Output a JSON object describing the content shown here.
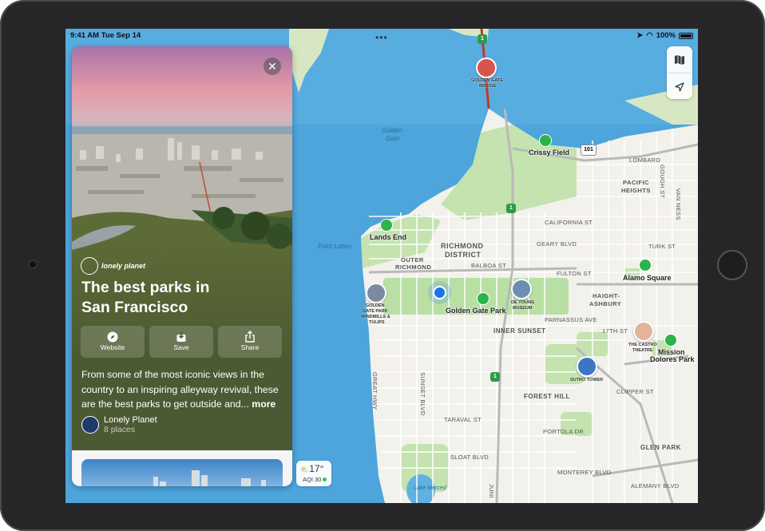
{
  "status_bar": {
    "time": "9:41 AM",
    "date": "Tue Sep 14",
    "battery": "100%"
  },
  "guide": {
    "brand": "lonely planet",
    "title_line1": "The best parks in",
    "title_line2": "San Francisco",
    "actions": [
      {
        "label": "Website",
        "icon": "compass-icon"
      },
      {
        "label": "Save",
        "icon": "save-tray-icon"
      },
      {
        "label": "Share",
        "icon": "share-icon"
      }
    ],
    "description": "From some of the most iconic views in the country to an inspiring alleyway revival, these are the best parks to get outside and...",
    "more_label": "more",
    "author_name": "Lonely Planet",
    "author_places": "8 places"
  },
  "weather": {
    "temperature": "17°",
    "aqi_label": "AQI 30"
  },
  "map": {
    "water_labels": {
      "golden": "Golden",
      "gate": "Gate",
      "point_lobos": "Point Lobos",
      "lake_merced": "Lake Merced"
    },
    "districts": {
      "richmond": "RICHMOND",
      "richmond2": "DISTRICT",
      "outer": "OUTER",
      "richmond3": "RICHMOND",
      "pacific": "PACIFIC",
      "heights": "HEIGHTS",
      "haight": "HAIGHT-",
      "ashbury": "ASHBURY",
      "inner_sunset": "INNER SUNSET",
      "forest_hill": "FOREST HILL",
      "glen_park": "GLEN PARK"
    },
    "streets": {
      "california": "CALIFORNIA ST",
      "geary": "GEARY BLVD",
      "balboa": "BALBOA ST",
      "fulton": "FULTON ST",
      "lombard": "LOMBARD",
      "turk": "TURK ST",
      "parnassus": "PARNASSUS AVE",
      "seventeenth": "17TH ST",
      "taraval": "TARAVAL ST",
      "portola": "PORTOLA DR",
      "clipper": "CLIPPER ST",
      "sloat": "SLOAT BLVD",
      "monterey": "MONTEREY BLVD",
      "alemany": "ALEMANY BLVD",
      "sunset": "SUNSET BLVD",
      "great_highway": "GREAT HWY",
      "gough": "GOUGH ST",
      "van_ness": "VAN NESS",
      "juni": "JUNI"
    },
    "highways": {
      "h101": "101",
      "h1a": "1",
      "h1b": "1",
      "h1c": "1"
    },
    "parks": {
      "crissy": "Crissy Field",
      "lands_end": "Lands End",
      "ggpark": "Golden Gate Park",
      "alamo": "Alamo Square",
      "mission1": "Mission",
      "mission2": "Dolores Park"
    },
    "pois": {
      "bridge1": "GOLDEN GATE",
      "bridge2": "BRIDGE",
      "windmills1": "GOLDEN",
      "windmills2": "GATE PARK",
      "windmills3": "WINDMILLS &",
      "windmills4": "TULIPS",
      "deyoung1": "DE YOUNG",
      "deyoung2": "MUSEUM",
      "sutro": "SUTRO TOWER",
      "castro1": "THE CASTRO",
      "castro2": "THEATRE"
    }
  },
  "colors": {
    "card_bg": "#4c5a33",
    "park_green": "#2db34a",
    "location_blue": "#1a73e8",
    "water": "#4da5dc",
    "land": "#f3f1ec",
    "park_fill": "#b9dfa5"
  }
}
